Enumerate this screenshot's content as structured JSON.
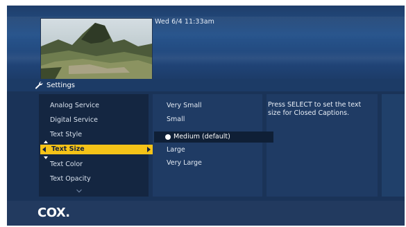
{
  "header": {
    "datetime": "Wed 6/4  11:33am",
    "title": "Settings",
    "title_icon": "wrench-icon"
  },
  "menu": {
    "items": [
      {
        "label": "Analog Service"
      },
      {
        "label": "Digital Service"
      },
      {
        "label": "Text Style"
      },
      {
        "label": "Text Size",
        "selected": true
      },
      {
        "label": "Text Color"
      },
      {
        "label": "Text Opacity"
      }
    ],
    "scroll_down_icon": "chevron-down-icon"
  },
  "options": {
    "items": [
      {
        "label": "Very Small"
      },
      {
        "label": "Small"
      },
      {
        "label": "Medium (default)",
        "selected": true
      },
      {
        "label": "Large"
      },
      {
        "label": "Very Large"
      }
    ]
  },
  "help": {
    "text": "Press SELECT to set the text size for Closed Captions."
  },
  "footer": {
    "logo": "COX."
  },
  "colors": {
    "highlight": "#f5c318",
    "background": "#14213a",
    "panel": "#1f3b64"
  }
}
